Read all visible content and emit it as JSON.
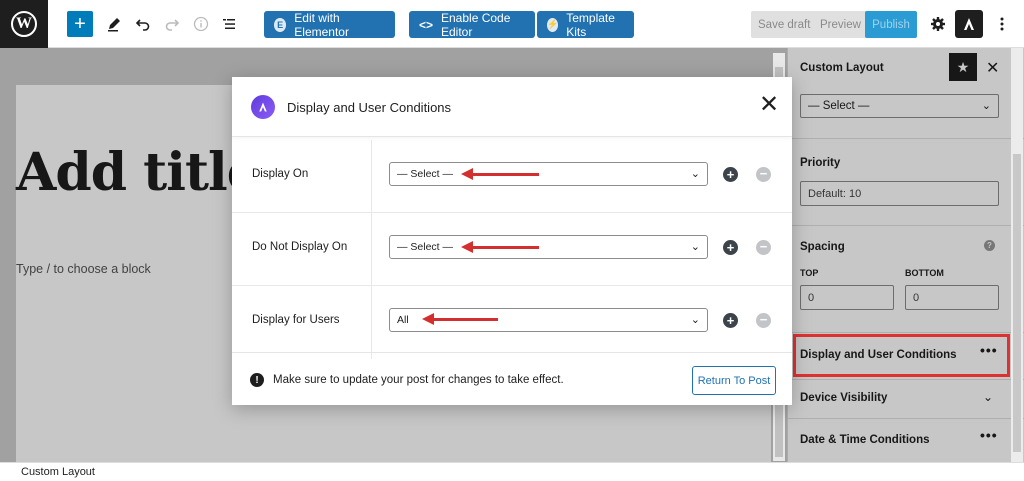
{
  "toolbar": {
    "edit_elementor": "Edit with Elementor",
    "enable_code_editor": "Enable Code Editor",
    "template_kits": "Template Kits",
    "save_draft": "Save draft",
    "preview": "Preview",
    "publish": "Publish"
  },
  "editor": {
    "title_placeholder": "Add title",
    "block_hint": "Type / to choose a block"
  },
  "sidebar": {
    "custom_layout_label": "Custom Layout",
    "custom_layout_select": "— Select —",
    "priority_label": "Priority",
    "priority_value": "Default: 10",
    "spacing_label": "Spacing",
    "spacing_top_label": "TOP",
    "spacing_bottom_label": "BOTTOM",
    "spacing_top_value": "0",
    "spacing_bottom_value": "0",
    "display_conditions_label": "Display and User Conditions",
    "device_visibility_label": "Device Visibility",
    "date_time_label": "Date & Time Conditions"
  },
  "modal": {
    "title": "Display and User Conditions",
    "rows": [
      {
        "label": "Display On",
        "value": "— Select —"
      },
      {
        "label": "Do Not Display On",
        "value": "— Select —"
      },
      {
        "label": "Display for Users",
        "value": "All"
      }
    ],
    "notice": "Make sure to update your post for changes to take effect.",
    "return_button": "Return To Post"
  },
  "footer": {
    "breadcrumb": "Custom Layout"
  },
  "colors": {
    "wp_blue": "#2271b1",
    "annotation_red": "#e03131",
    "astra_purple": "#6b46e5"
  }
}
